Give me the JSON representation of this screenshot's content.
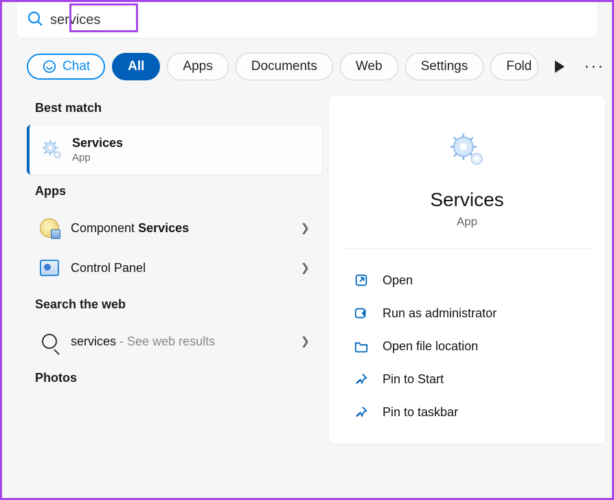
{
  "search": {
    "value": "services"
  },
  "filters": {
    "chat": "Chat",
    "items": [
      "All",
      "Apps",
      "Documents",
      "Web",
      "Settings",
      "Folders"
    ],
    "active_index": 0
  },
  "left": {
    "best_match_header": "Best match",
    "best_match": {
      "title": "Services",
      "subtitle": "App"
    },
    "apps_header": "Apps",
    "apps": [
      {
        "prefix": "Component ",
        "bold": "Services"
      },
      {
        "prefix": "Control Panel",
        "bold": ""
      }
    ],
    "web_header": "Search the web",
    "web_item": {
      "query": "services",
      "suffix": " - See web results"
    },
    "photos_header": "Photos"
  },
  "detail": {
    "title": "Services",
    "subtitle": "App",
    "actions": [
      {
        "icon": "open",
        "label": "Open"
      },
      {
        "icon": "shield",
        "label": "Run as administrator"
      },
      {
        "icon": "folder",
        "label": "Open file location"
      },
      {
        "icon": "pin",
        "label": "Pin to Start"
      },
      {
        "icon": "pin",
        "label": "Pin to taskbar"
      }
    ]
  }
}
